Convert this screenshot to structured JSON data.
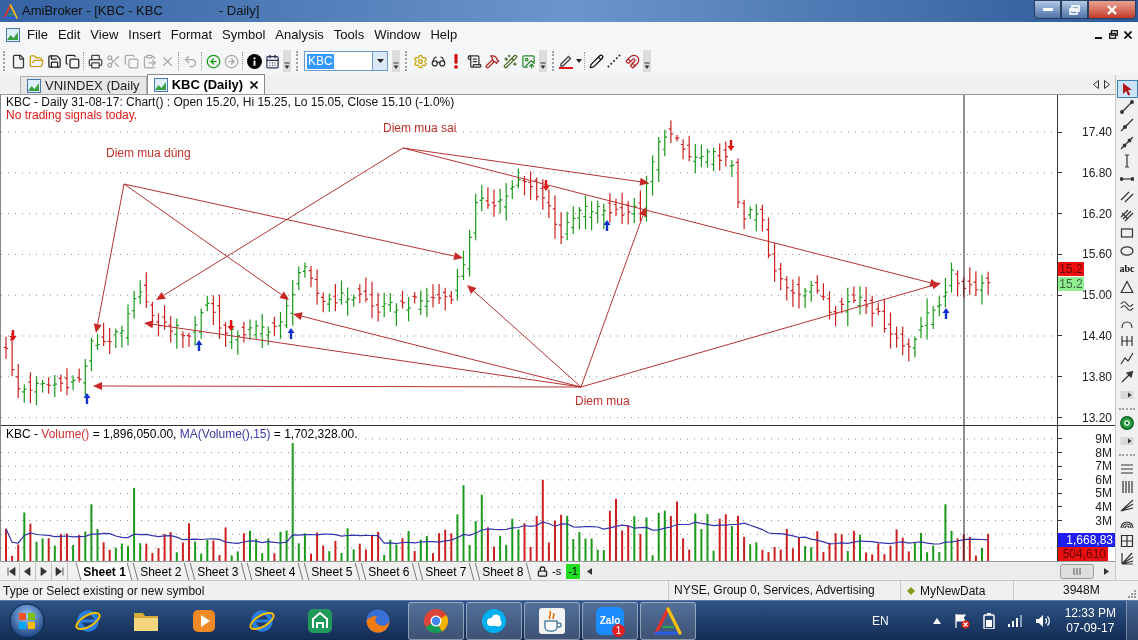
{
  "window": {
    "title": "AmiBroker - [KBC - KBC",
    "title_suffix": "- Daily]"
  },
  "menu": [
    "File",
    "Edit",
    "View",
    "Insert",
    "Format",
    "Symbol",
    "Analysis",
    "Tools",
    "Window",
    "Help"
  ],
  "toolbar": [
    {
      "kind": "buttons",
      "groups": [
        [
          {
            "kind": "new",
            "disabled": false
          },
          {
            "kind": "open",
            "disabled": false
          },
          {
            "kind": "save",
            "disabled": false
          },
          {
            "kind": "saveall",
            "disabled": false
          }
        ],
        [
          {
            "kind": "print",
            "disabled": false
          },
          {
            "kind": "cut",
            "disabled": true
          },
          {
            "kind": "copy",
            "disabled": true
          },
          {
            "kind": "paste",
            "disabled": true
          },
          {
            "kind": "delete",
            "disabled": true
          }
        ],
        [
          {
            "kind": "undo",
            "disabled": true
          }
        ],
        [
          {
            "kind": "back",
            "disabled": false
          },
          {
            "kind": "forward",
            "disabled": true
          }
        ],
        [
          {
            "kind": "info",
            "disabled": false
          },
          {
            "kind": "calendar",
            "disabled": false
          }
        ]
      ]
    },
    {
      "kind": "symbol",
      "value": "KBC"
    },
    {
      "kind": "buttons",
      "groups": [
        [
          {
            "kind": "gear",
            "disabled": false
          },
          {
            "kind": "glasses",
            "disabled": false
          },
          {
            "kind": "alert",
            "disabled": false
          },
          {
            "kind": "scroll",
            "disabled": false
          },
          {
            "kind": "hammer",
            "disabled": false
          },
          {
            "kind": "wand",
            "disabled": false
          },
          {
            "kind": "export",
            "disabled": false
          }
        ]
      ]
    },
    {
      "kind": "buttons",
      "groups": [
        [
          {
            "kind": "pen",
            "disabled": false
          }
        ],
        [
          {
            "kind": "pencil",
            "disabled": false
          },
          {
            "kind": "dotted",
            "disabled": false
          },
          {
            "kind": "magnet",
            "disabled": false
          }
        ]
      ]
    }
  ],
  "chart_tabs": [
    {
      "label": "VNINDEX (Daily",
      "selected": false
    },
    {
      "label": "KBC (Daily)",
      "selected": true
    }
  ],
  "price_pane": {
    "header": "KBC - Daily 31-08-17: Chart() : Open 15.20, Hi 15.25, Lo 15.05, Close 15.10 (-1.0%)",
    "signal_note": "No trading signals today.",
    "annotations": [
      {
        "text": "Diem mua dúng"
      },
      {
        "text": "Diem mua sai"
      },
      {
        "text": "Diem mua"
      }
    ],
    "axis_labels": [
      "17.40",
      "16.80",
      "16.20",
      "15.60",
      "15.00",
      "14.40",
      "13.80",
      "13.20"
    ],
    "price_badges": [
      {
        "text": "15.2",
        "color": "#f01010"
      },
      {
        "text": "15.2",
        "color": "#90ee90"
      }
    ]
  },
  "volume_pane": {
    "legend": [
      {
        "text": "KBC - ",
        "color": "#000000"
      },
      {
        "text": "Volume()",
        "color": "#d03030"
      },
      {
        "text": " = 1,896,050.00, ",
        "color": "#000000"
      },
      {
        "text": "MA(Volume(),15)",
        "color": "#3a3aa0"
      },
      {
        "text": " = 1,702,328.00.",
        "color": "#000000"
      }
    ],
    "axis_labels": [
      "9M",
      "8M",
      "7M",
      "6M",
      "5M",
      "4M",
      "3M"
    ],
    "value_badges": [
      {
        "text": "1,668,83",
        "color": "#1e1ef0"
      },
      {
        "text": "504,610",
        "color": "#e81010"
      }
    ]
  },
  "drawing_toolbar": [
    {
      "tools": [
        {
          "kind": "select",
          "selected": true
        },
        {
          "kind": "line",
          "selected": false
        },
        {
          "kind": "ray",
          "selected": false
        },
        {
          "kind": "extended",
          "selected": false
        },
        {
          "kind": "vertical",
          "selected": false
        },
        {
          "kind": "horizontal",
          "selected": false
        },
        {
          "kind": "parallel",
          "selected": false
        },
        {
          "kind": "pitchfork",
          "selected": false
        },
        {
          "kind": "rectangle",
          "selected": false
        },
        {
          "kind": "ellipse",
          "selected": false
        },
        {
          "kind": "text",
          "label": "abc",
          "selected": false
        },
        {
          "kind": "triangle",
          "selected": false
        },
        {
          "kind": "sine",
          "selected": false
        },
        {
          "kind": "arc",
          "selected": false
        },
        {
          "kind": "bracket",
          "selected": false
        },
        {
          "kind": "zigzag",
          "selected": false
        },
        {
          "kind": "arrow",
          "selected": false
        },
        {
          "kind": "more",
          "selected": false
        }
      ]
    },
    {
      "tools": [
        {
          "kind": "gann",
          "selected": false
        },
        {
          "kind": "more",
          "selected": false
        }
      ]
    },
    {
      "tools": [
        {
          "kind": "hlines",
          "selected": false
        },
        {
          "kind": "vlines",
          "selected": false
        },
        {
          "kind": "fan",
          "selected": false
        },
        {
          "kind": "arcs",
          "selected": false
        },
        {
          "kind": "grid",
          "selected": false
        },
        {
          "kind": "speedfan",
          "selected": false
        }
      ]
    }
  ],
  "sheet_tabs": [
    {
      "label": "Sheet 1",
      "selected": true
    },
    {
      "label": "Sheet 2",
      "selected": false
    },
    {
      "label": "Sheet 3",
      "selected": false
    },
    {
      "label": "Sheet 4",
      "selected": false
    },
    {
      "label": "Sheet 5",
      "selected": false
    },
    {
      "label": "Sheet 6",
      "selected": false
    },
    {
      "label": "Sheet 7",
      "selected": false
    },
    {
      "label": "Sheet 8",
      "selected": false
    }
  ],
  "sheet_bar": {
    "label_1": "-s",
    "label_2": "-1"
  },
  "status_bar": {
    "hint": "Type or Select existing or new symbol",
    "symbol_info": "NYSE, Group 0, Services, Advertising",
    "database": "MyNewData",
    "memory": "3948M"
  },
  "taskbar": {
    "apps": [
      {
        "kind": "ebrowser",
        "running": false
      },
      {
        "kind": "folder",
        "running": false
      },
      {
        "kind": "player",
        "running": false
      },
      {
        "kind": "ebrowser",
        "running": false
      },
      {
        "kind": "house",
        "running": false
      },
      {
        "kind": "foxbrowser",
        "running": false
      },
      {
        "kind": "roundbrowser",
        "running": true
      },
      {
        "kind": "cloud",
        "running": true
      },
      {
        "kind": "cup",
        "running": true
      },
      {
        "kind": "chat",
        "running": true,
        "label": "Zalo",
        "badge": "1"
      },
      {
        "kind": "triangle",
        "running": true
      }
    ],
    "language": "EN",
    "time": "12:33 PM",
    "date": "07-09-17"
  }
}
